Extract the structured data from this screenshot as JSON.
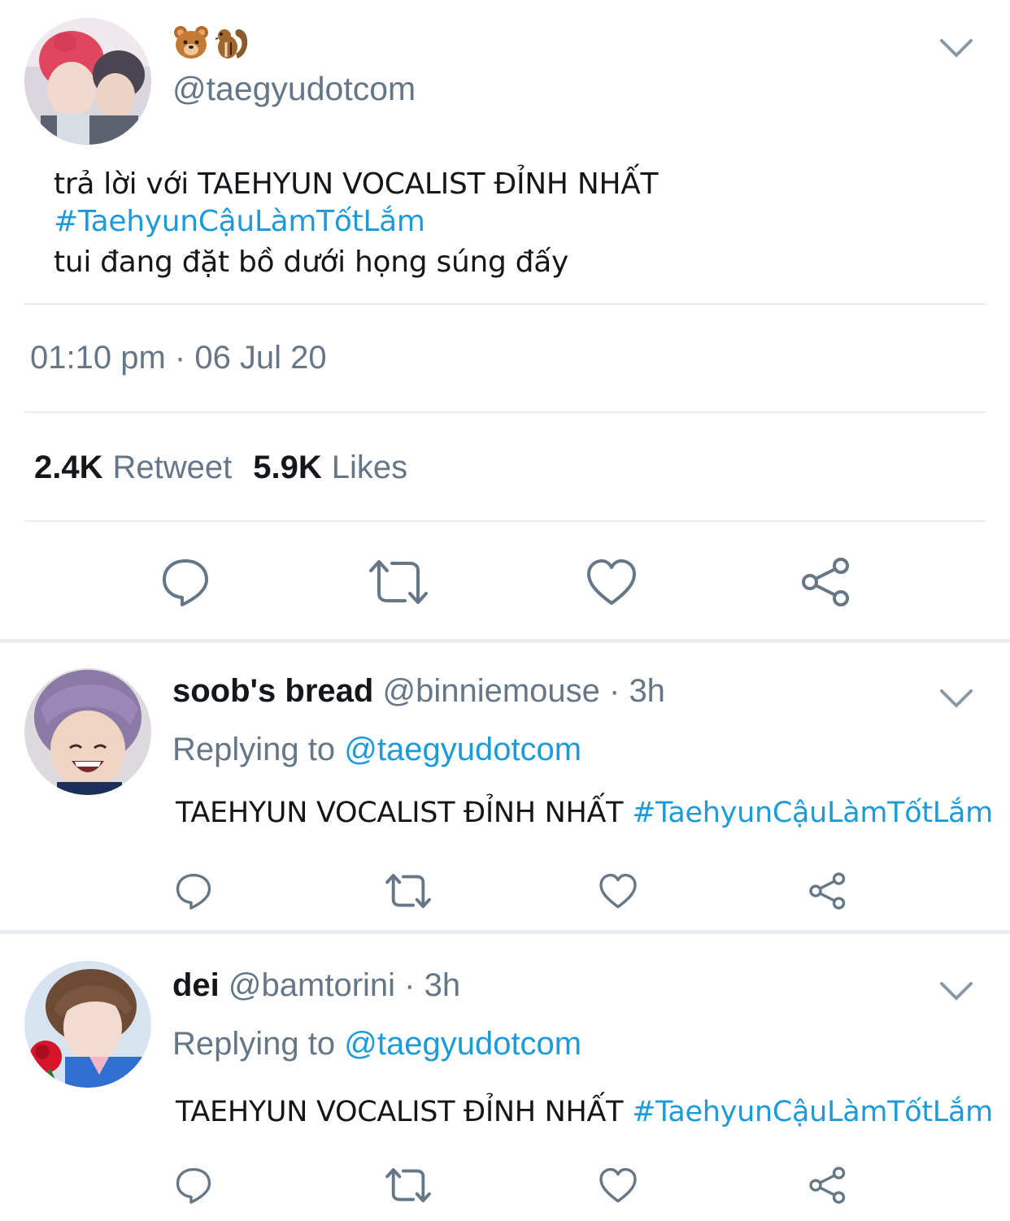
{
  "main_tweet": {
    "display_name_emojis": [
      "bear-face-emoji",
      "chipmunk-emoji"
    ],
    "handle": "@taegyudotcom",
    "text_line1": "trả lời với TAEHYUN VOCALIST ĐỈNH NHẤT",
    "hashtag": "#TaehyunCậuLàmTốtLắm",
    "text_line3": "tui đang đặt bồ dưới họng súng đấy",
    "timestamp": "01:10 pm · 06 Jul 20",
    "retweet_count": "2.4K",
    "retweet_label": "Retweet",
    "likes_count": "5.9K",
    "likes_label": "Likes"
  },
  "replies": [
    {
      "name": "soob's bread",
      "meta": "@binniemouse · 3h",
      "replying_label": "Replying to",
      "replying_to": "@taegyudotcom",
      "text": "TAEHYUN VOCALIST ĐỈNH NHẤT",
      "hashtag": "#TaehyunCậuLàmTốtLắm"
    },
    {
      "name": "dei",
      "meta": "@bamtorini · 3h",
      "replying_label": "Replying to",
      "replying_to": "@taegyudotcom",
      "text": "TAEHYUN VOCALIST ĐỈNH NHẤT",
      "hashtag": "#TaehyunCậuLàmTốtLắm"
    }
  ],
  "icons": [
    "comment-icon",
    "retweet-icon",
    "like-icon",
    "share-icon",
    "chevron-down-icon"
  ],
  "colors": {
    "accent": "#1d9bd8",
    "muted": "#657786",
    "icon": "#657786",
    "divider": "#e6ecf0"
  }
}
